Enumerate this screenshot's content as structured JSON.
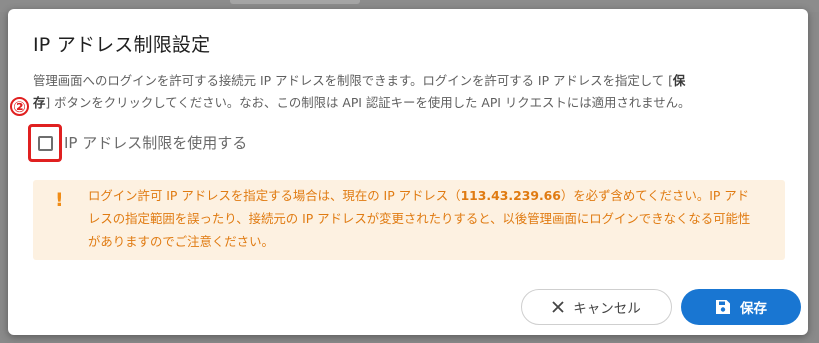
{
  "dialog": {
    "title": "IP アドレス制限設定",
    "description_part1": "管理画面へのログインを許可する接続元 IP アドレスを制限できます。ログインを許可する IP アドレスを指定して [",
    "description_bold1": "保",
    "description_bold2": "存",
    "description_part2": "] ボタンをクリックしてください。なお、この制限は API 認証キーを使用した API リクエストには適用されません。",
    "step_marker": "②",
    "checkbox_label": "IP アドレス制限を使用する",
    "checkbox_checked": false,
    "warning": {
      "icon": "exclamation-icon",
      "text_part1": "ログイン許可 IP アドレスを指定する場合は、現在の IP アドレス（",
      "ip_address": "113.43.239.66",
      "text_part2": "）を必ず含めてください。IP アドレスの指定範囲を誤ったり、接続元の IP アドレスが変更されたりすると、以後管理画面にログインできなくなる可能性がありますのでご注意ください。"
    },
    "buttons": {
      "cancel_label": "キャンセル",
      "save_label": "保存"
    }
  },
  "colors": {
    "primary": "#1976d2",
    "warning_bg": "#fdf1e1",
    "warning_text": "#e07b12",
    "annotation_red": "#e02020"
  }
}
